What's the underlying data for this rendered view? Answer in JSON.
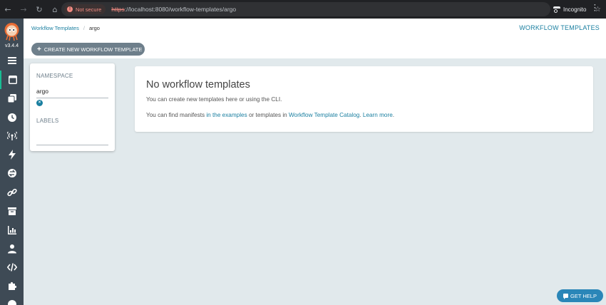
{
  "browser": {
    "back_icon": "←",
    "forward_icon": "→",
    "reload_icon": "↻",
    "home_icon": "⌂",
    "security_label": "Not secure",
    "url_protocol": "https",
    "url_rest": "://localhost:8080/workflow-templates/argo",
    "bookmark_icon": "☆",
    "incognito_label": "Incognito",
    "menu_icon": "⋮"
  },
  "sidebar": {
    "version": "v3.4.4",
    "items": [
      {
        "name": "menu-icon"
      },
      {
        "name": "workflow-templates-icon",
        "active": true
      },
      {
        "name": "cluster-workflow-templates-icon"
      },
      {
        "name": "cron-workflows-icon"
      },
      {
        "name": "event-sources-icon"
      },
      {
        "name": "sensors-icon"
      },
      {
        "name": "event-flow-icon"
      },
      {
        "name": "webhooks-icon"
      },
      {
        "name": "archived-workflows-icon"
      },
      {
        "name": "reports-icon"
      },
      {
        "name": "user-icon"
      },
      {
        "name": "api-docs-icon"
      },
      {
        "name": "plugins-icon"
      },
      {
        "name": "help-icon"
      }
    ]
  },
  "header": {
    "breadcrumb_link": "Workflow Templates",
    "breadcrumb_separator": "/",
    "breadcrumb_current": "argo",
    "title": "WORKFLOW TEMPLATES",
    "create_button": "CREATE NEW WORKFLOW TEMPLATE",
    "create_icon": "+"
  },
  "filters": {
    "namespace_label": "NAMESPACE",
    "namespace_value": "argo",
    "clear_icon": "×",
    "labels_label": "LABELS"
  },
  "empty_state": {
    "title": "No workflow templates",
    "line1": "You can create new templates here or using the CLI.",
    "line2_prefix": "You can find manifests ",
    "line2_link1": "in the examples",
    "line2_middle": " or templates in ",
    "line2_link2": "Workflow Template Catalog",
    "line2_sep": ". ",
    "line2_link3": "Learn more",
    "line2_suffix": "."
  },
  "help": {
    "label": "GET HELP",
    "icon": "chat-bubble-icon"
  },
  "colors": {
    "sidebar_bg": "#3e4a55",
    "accent": "#1a7fa0",
    "active_indicator": "#18be94",
    "page_bg": "#e1e9ec",
    "button_bg": "#6e7f8b"
  }
}
